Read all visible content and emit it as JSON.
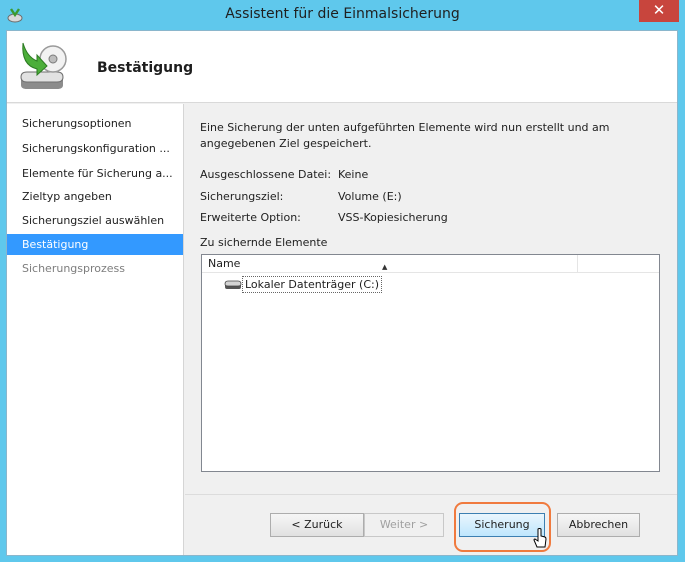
{
  "window": {
    "title": "Assistent für die Einmalsicherung",
    "close_glyph": "✕"
  },
  "header": {
    "page_title": "Bestätigung"
  },
  "sidebar": {
    "items": [
      {
        "label": "Sicherungsoptionen",
        "state": "normal"
      },
      {
        "label": "Sicherungskonfiguration ...",
        "state": "normal"
      },
      {
        "label": "Elemente für Sicherung a...",
        "state": "normal"
      },
      {
        "label": "Zieltyp angeben",
        "state": "normal"
      },
      {
        "label": "Sicherungsziel auswählen",
        "state": "normal"
      },
      {
        "label": "Bestätigung",
        "state": "active"
      },
      {
        "label": "Sicherungsprozess",
        "state": "disabled"
      }
    ]
  },
  "main": {
    "intro": "Eine Sicherung der unten aufgeführten Elemente wird nun erstellt und am angegebenen Ziel gespeichert.",
    "details": [
      {
        "label": "Ausgeschlossene Datei:",
        "value": "Keine"
      },
      {
        "label": "Sicherungsziel:",
        "value": "Volume (E:)"
      },
      {
        "label": "Erweiterte Option:",
        "value": "VSS-Kopiesicherung"
      }
    ],
    "items_label": "Zu sichernde Elemente",
    "list": {
      "column_name": "Name",
      "sort_glyph": "▲",
      "rows": [
        "Lokaler Datenträger (C:)"
      ]
    }
  },
  "buttons": {
    "back": "< Zurück",
    "next": "Weiter >",
    "backup": "Sicherung",
    "cancel": "Abbrechen"
  },
  "icons": {
    "app": "backup-app-icon",
    "header": "backup-drive-icon",
    "drive": "hard-drive-icon",
    "cursor": "mouse-pointer-icon"
  },
  "colors": {
    "titlebar": "#5fc8ec",
    "selection": "#3399ff",
    "highlight": "#f07a3e",
    "close": "#c8453d"
  }
}
